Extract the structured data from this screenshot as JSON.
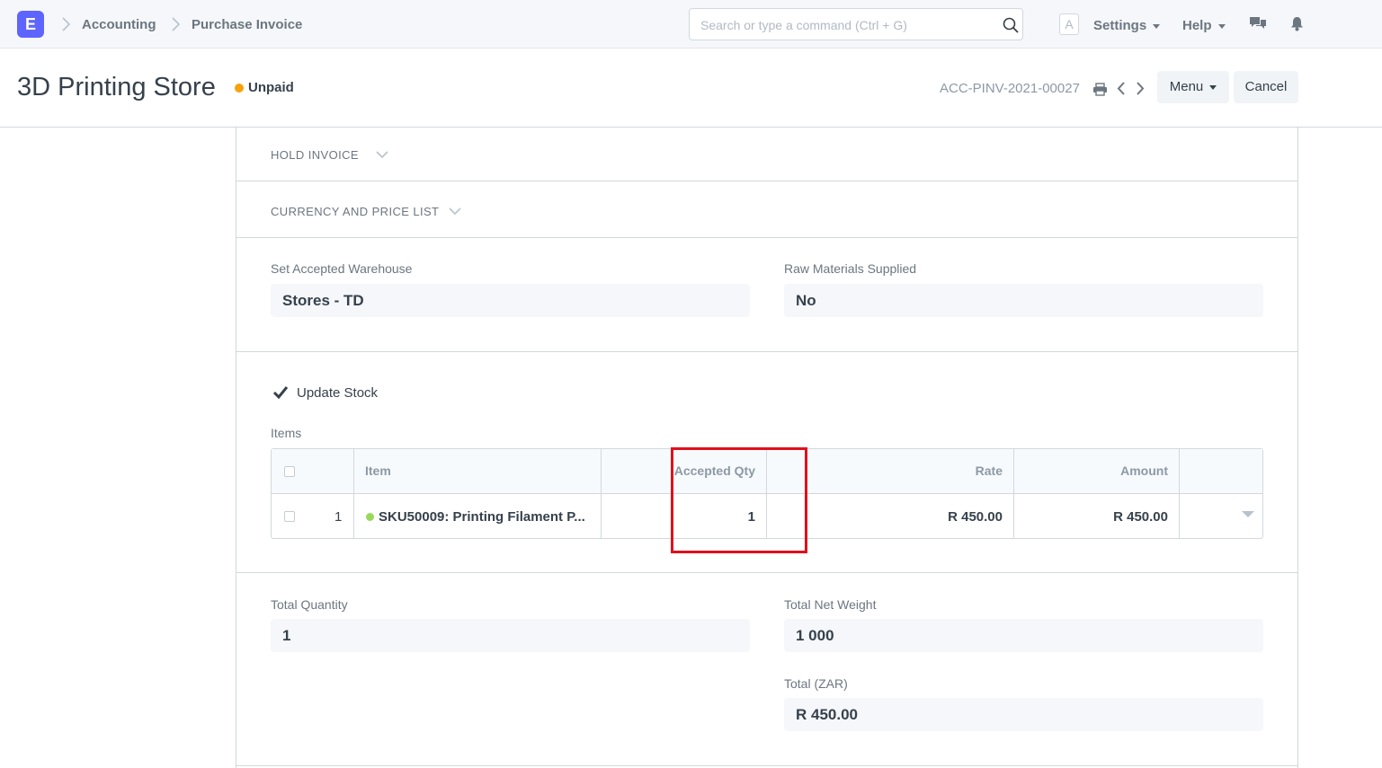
{
  "app": {
    "logo_letter": "E"
  },
  "breadcrumb": [
    "Accounting",
    "Purchase Invoice"
  ],
  "search": {
    "placeholder": "Search or type a command (Ctrl + G)",
    "value": ""
  },
  "navbar": {
    "avatar_letter": "A",
    "settings_label": "Settings",
    "help_label": "Help"
  },
  "page": {
    "title": "3D Printing Store",
    "status": "Unpaid",
    "status_color": "#f8a20a",
    "doc_name": "ACC-PINV-2021-00027",
    "menu_label": "Menu",
    "cancel_label": "Cancel"
  },
  "sections": {
    "hold_invoice": "HOLD INVOICE",
    "currency_price_list": "CURRENCY AND PRICE LIST"
  },
  "fields": {
    "set_accepted_warehouse": {
      "label": "Set Accepted Warehouse",
      "value": "Stores - TD"
    },
    "raw_materials_supplied": {
      "label": "Raw Materials Supplied",
      "value": "No"
    },
    "update_stock": {
      "label": "Update Stock",
      "checked": true
    },
    "total_quantity": {
      "label": "Total Quantity",
      "value": "1"
    },
    "total_net_weight": {
      "label": "Total Net Weight",
      "value": "1 000"
    },
    "total_zar": {
      "label": "Total (ZAR)",
      "value": "R 450.00"
    }
  },
  "items": {
    "label": "Items",
    "columns": [
      "Item",
      "Accepted Qty",
      "Rate",
      "Amount"
    ],
    "rows": [
      {
        "idx": "1",
        "item": "SKU50009: Printing Filament P...",
        "accepted_qty": "1",
        "rate": "R 450.00",
        "amount": "R 450.00"
      }
    ]
  },
  "colors": {
    "accent": "#5e64ff",
    "highlight": "#e0101c",
    "item_status": "#98d85b"
  }
}
